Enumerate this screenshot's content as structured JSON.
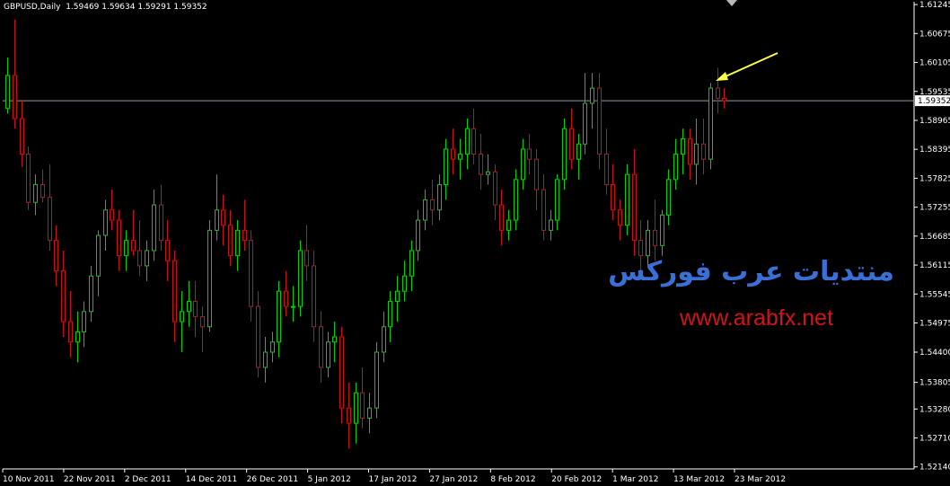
{
  "header": {
    "symbol": "GBPUSD,Daily",
    "ohlc": "1.59469 1.59634 1.59291 1.59352"
  },
  "watermark": {
    "arabic": "منتديات عرب فوركس",
    "url": "www.arabfx.net"
  },
  "colors": {
    "background": "#000000",
    "bull": "#00d400",
    "bear": "#d01010",
    "grid_text": "#ffffff",
    "current_price_line": "#8a9bb0",
    "arrow": "#ffff40"
  },
  "icons": [
    "arrow-annotation-icon",
    "expert-marker-icon"
  ],
  "chart_data": {
    "type": "candlestick",
    "symbol": "GBPUSD",
    "timeframe": "Daily",
    "ylim": [
      1.521,
      1.613
    ],
    "y_ticks": [
      "1.61245",
      "1.60675",
      "1.60105",
      "1.59535",
      "1.58965",
      "1.58395",
      "1.57825",
      "1.57255",
      "1.56685",
      "1.56115",
      "1.55545",
      "1.54975",
      "1.54400",
      "1.53805",
      "1.53280",
      "1.52710",
      "1.52140"
    ],
    "current_price": "1.59352",
    "x_labels": [
      "10 Nov 2011",
      "22 Nov 2011",
      "2 Dec 2011",
      "14 Dec 2011",
      "26 Dec 2011",
      "5 Jan 2012",
      "17 Jan 2012",
      "27 Jan 2012",
      "8 Feb 2012",
      "20 Feb 2012",
      "1 Mar 2012",
      "13 Mar 2012",
      "23 Mar 2012"
    ],
    "candles": [
      [
        1.592,
        1.602,
        1.591,
        1.5985
      ],
      [
        1.5985,
        1.6095,
        1.588,
        1.59
      ],
      [
        1.59,
        1.5935,
        1.5805,
        1.583
      ],
      [
        1.583,
        1.5845,
        1.572,
        1.5735
      ],
      [
        1.5735,
        1.579,
        1.571,
        1.577
      ],
      [
        1.577,
        1.58,
        1.5735,
        1.5745
      ],
      [
        1.5745,
        1.581,
        1.564,
        1.566
      ],
      [
        1.566,
        1.569,
        1.557,
        1.56
      ],
      [
        1.56,
        1.564,
        1.547,
        1.55
      ],
      [
        1.55,
        1.556,
        1.543,
        1.546
      ],
      [
        1.546,
        1.552,
        1.542,
        1.548
      ],
      [
        1.548,
        1.554,
        1.545,
        1.552
      ],
      [
        1.552,
        1.561,
        1.55,
        1.559
      ],
      [
        1.559,
        1.568,
        1.555,
        1.567
      ],
      [
        1.567,
        1.574,
        1.564,
        1.572
      ],
      [
        1.572,
        1.576,
        1.568,
        1.57
      ],
      [
        1.57,
        1.572,
        1.56,
        1.563
      ],
      [
        1.563,
        1.568,
        1.56,
        1.566
      ],
      [
        1.566,
        1.572,
        1.563,
        1.564
      ],
      [
        1.564,
        1.57,
        1.559,
        1.561
      ],
      [
        1.561,
        1.566,
        1.558,
        1.564
      ],
      [
        1.564,
        1.576,
        1.562,
        1.573
      ],
      [
        1.573,
        1.577,
        1.564,
        1.566
      ],
      [
        1.566,
        1.57,
        1.558,
        1.562
      ],
      [
        1.562,
        1.564,
        1.546,
        1.55
      ],
      [
        1.55,
        1.556,
        1.544,
        1.552
      ],
      [
        1.552,
        1.558,
        1.549,
        1.554
      ],
      [
        1.554,
        1.558,
        1.547,
        1.551
      ],
      [
        1.551,
        1.553,
        1.544,
        1.549
      ],
      [
        1.549,
        1.57,
        1.548,
        1.568
      ],
      [
        1.568,
        1.579,
        1.566,
        1.572
      ],
      [
        1.572,
        1.575,
        1.565,
        1.569
      ],
      [
        1.569,
        1.572,
        1.561,
        1.563
      ],
      [
        1.563,
        1.57,
        1.56,
        1.568
      ],
      [
        1.568,
        1.574,
        1.564,
        1.566
      ],
      [
        1.566,
        1.568,
        1.55,
        1.553
      ],
      [
        1.553,
        1.556,
        1.539,
        1.541
      ],
      [
        1.541,
        1.547,
        1.538,
        1.544
      ],
      [
        1.544,
        1.548,
        1.542,
        1.546
      ],
      [
        1.546,
        1.558,
        1.543,
        1.556
      ],
      [
        1.556,
        1.56,
        1.551,
        1.553
      ],
      [
        1.553,
        1.557,
        1.55,
        1.553
      ],
      [
        1.553,
        1.566,
        1.551,
        1.564
      ],
      [
        1.564,
        1.569,
        1.558,
        1.561
      ],
      [
        1.561,
        1.564,
        1.546,
        1.549
      ],
      [
        1.549,
        1.552,
        1.538,
        1.541
      ],
      [
        1.541,
        1.548,
        1.539,
        1.546
      ],
      [
        1.546,
        1.55,
        1.542,
        1.547
      ],
      [
        1.547,
        1.549,
        1.53,
        1.533
      ],
      [
        1.533,
        1.538,
        1.525,
        1.53
      ],
      [
        1.53,
        1.538,
        1.526,
        1.536
      ],
      [
        1.536,
        1.541,
        1.529,
        1.531
      ],
      [
        1.531,
        1.536,
        1.528,
        1.533
      ],
      [
        1.533,
        1.546,
        1.531,
        1.544
      ],
      [
        1.544,
        1.552,
        1.542,
        1.549
      ],
      [
        1.549,
        1.556,
        1.546,
        1.554
      ],
      [
        1.554,
        1.559,
        1.55,
        1.556
      ],
      [
        1.556,
        1.562,
        1.554,
        1.559
      ],
      [
        1.559,
        1.566,
        1.556,
        1.564
      ],
      [
        1.564,
        1.572,
        1.562,
        1.57
      ],
      [
        1.57,
        1.576,
        1.568,
        1.574
      ],
      [
        1.574,
        1.578,
        1.569,
        1.572
      ],
      [
        1.572,
        1.579,
        1.57,
        1.577
      ],
      [
        1.577,
        1.586,
        1.574,
        1.584
      ],
      [
        1.584,
        1.588,
        1.579,
        1.582
      ],
      [
        1.582,
        1.586,
        1.578,
        1.583
      ],
      [
        1.583,
        1.59,
        1.58,
        1.588
      ],
      [
        1.588,
        1.592,
        1.581,
        1.583
      ],
      [
        1.583,
        1.587,
        1.576,
        1.579
      ],
      [
        1.579,
        1.583,
        1.577,
        1.5795
      ],
      [
        1.5795,
        1.581,
        1.57,
        1.573
      ],
      [
        1.573,
        1.576,
        1.565,
        1.568
      ],
      [
        1.568,
        1.572,
        1.566,
        1.57
      ],
      [
        1.57,
        1.58,
        1.568,
        1.578
      ],
      [
        1.578,
        1.586,
        1.576,
        1.584
      ],
      [
        1.584,
        1.587,
        1.579,
        1.582
      ],
      [
        1.582,
        1.584,
        1.572,
        1.576
      ],
      [
        1.576,
        1.579,
        1.566,
        1.568
      ],
      [
        1.568,
        1.572,
        1.566,
        1.57
      ],
      [
        1.57,
        1.579,
        1.568,
        1.578
      ],
      [
        1.578,
        1.59,
        1.576,
        1.588
      ],
      [
        1.588,
        1.592,
        1.58,
        1.582
      ],
      [
        1.582,
        1.587,
        1.578,
        1.585
      ],
      [
        1.585,
        1.599,
        1.583,
        1.593
      ],
      [
        1.593,
        1.599,
        1.588,
        1.596
      ],
      [
        1.596,
        1.599,
        1.58,
        1.583
      ],
      [
        1.583,
        1.588,
        1.575,
        1.577
      ],
      [
        1.577,
        1.581,
        1.57,
        1.572
      ],
      [
        1.572,
        1.574,
        1.566,
        1.569
      ],
      [
        1.569,
        1.581,
        1.567,
        1.579
      ],
      [
        1.579,
        1.584,
        1.563,
        1.566
      ],
      [
        1.566,
        1.57,
        1.56,
        1.563
      ],
      [
        1.563,
        1.57,
        1.561,
        1.568
      ],
      [
        1.568,
        1.574,
        1.562,
        1.565
      ],
      [
        1.565,
        1.572,
        1.563,
        1.571
      ],
      [
        1.571,
        1.58,
        1.569,
        1.578
      ],
      [
        1.578,
        1.586,
        1.576,
        1.583
      ],
      [
        1.583,
        1.588,
        1.579,
        1.586
      ],
      [
        1.586,
        1.588,
        1.578,
        1.581
      ],
      [
        1.581,
        1.59,
        1.577,
        1.585
      ],
      [
        1.585,
        1.59,
        1.579,
        1.582
      ],
      [
        1.582,
        1.597,
        1.58,
        1.596
      ],
      [
        1.596,
        1.6,
        1.591,
        1.594
      ],
      [
        1.594,
        1.596,
        1.592,
        1.5935
      ]
    ]
  }
}
